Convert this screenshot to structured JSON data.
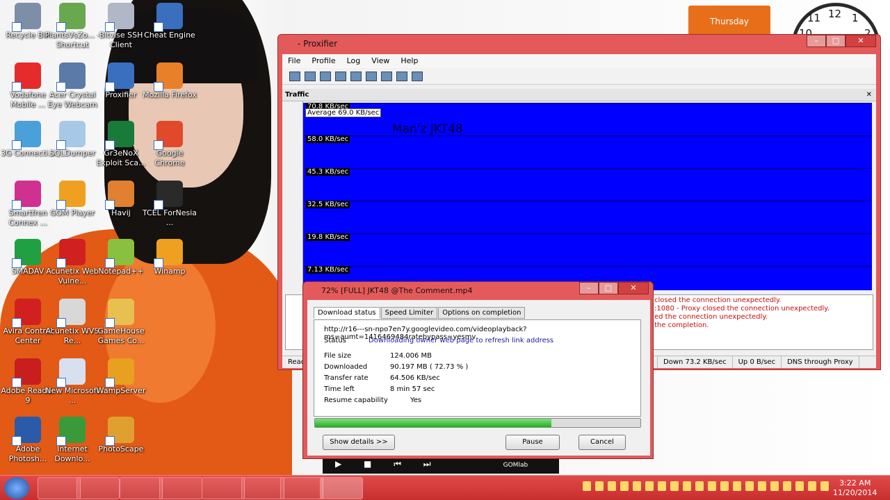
{
  "desktop": {
    "calendar_day": "Thursday",
    "clock_numbers": [
      "10",
      "11",
      "12",
      "1",
      "2"
    ],
    "icons": [
      {
        "label": "Recycle Bin",
        "color": "#7c8ea8"
      },
      {
        "label": "PlantsVsZo... - Shortcut",
        "color": "#6aa84f"
      },
      {
        "label": "Bitvise SSH Client",
        "color": "#b0b8c8"
      },
      {
        "label": "Cheat Engine",
        "color": "#3a6fc0"
      },
      {
        "label": "Vodafone Mobile ...",
        "color": "#e52b2b"
      },
      {
        "label": "Acer Crystal Eye Webcam",
        "color": "#5a7aa8"
      },
      {
        "label": "Proxifier",
        "color": "#3a6fc0"
      },
      {
        "label": "Mozilla Firefox",
        "color": "#e8802a"
      },
      {
        "label": "3G Connecti...",
        "color": "#4aa0d8"
      },
      {
        "label": "SQLDumper",
        "color": "#a8c8e8"
      },
      {
        "label": "Gr3eNoX Exploit Sca...",
        "color": "#1a7a3a"
      },
      {
        "label": "Google Chrome",
        "color": "#e04a2a"
      },
      {
        "label": "Smartfren Connex ...",
        "color": "#d03090"
      },
      {
        "label": "GOM Player",
        "color": "#f0a020"
      },
      {
        "label": "Havij",
        "color": "#e08030"
      },
      {
        "label": "TCEL ForNesia ...",
        "color": "#2a2a2a"
      },
      {
        "label": "SMADAV",
        "color": "#20a040"
      },
      {
        "label": "Acunetix Web Vulne...",
        "color": "#d02020"
      },
      {
        "label": "Notepad++",
        "color": "#8ac040"
      },
      {
        "label": "Winamp",
        "color": "#f0a020"
      },
      {
        "label": "Avira Control Center",
        "color": "#d02020"
      },
      {
        "label": "Acunetix WVS Re...",
        "color": "#d8d8d8"
      },
      {
        "label": "GameHouse Games Co...",
        "color": "#e8c050"
      },
      {
        "label": "Adobe Reader 9",
        "color": "#c81e1e"
      },
      {
        "label": "New Microsoft ...",
        "color": "#d8e0f0"
      },
      {
        "label": "WampServer",
        "color": "#e8a020"
      },
      {
        "label": "Adobe Photosh...",
        "color": "#2a5aa8"
      },
      {
        "label": "Internet Downlo...",
        "color": "#3a9a3a"
      },
      {
        "label": "PhotoScape",
        "color": "#e0a030"
      }
    ]
  },
  "proxifier": {
    "title": "- Proxifier",
    "menu": [
      "File",
      "Profile",
      "Log",
      "View",
      "Help"
    ],
    "traffic_title": "Traffic",
    "close_glyph": "✕",
    "watermark": "Man'z JKT48",
    "average": "Average 69.0 KB/sec",
    "grid_labels": [
      "70.8 KB/sec",
      "58.0 KB/sec",
      "45.3 KB/sec",
      "32.5 KB/sec",
      "19.8 KB/sec",
      "7.13 KB/sec"
    ],
    "log_lines": [
      "closed the connection unexpectedly.",
      ":1080 - Proxy closed the connection unexpectedly.",
      "ed the connection unexpectedly.",
      "the completion."
    ],
    "status": {
      "ready": "Read",
      "down": "Down 73.2 KB/sec",
      "up": "Up 0 B/sec",
      "dns": "DNS through Proxy"
    }
  },
  "download": {
    "title": "72% [FULL] JKT48 @The Comment.mp4",
    "tabs": [
      "Download status",
      "Speed Limiter",
      "Options on completion"
    ],
    "url": "http://r16---sn-npo7en7y.googlevideo.com/videoplayback?ms=aumt=1416469484ratebypass=yesmv",
    "status_label": "Status",
    "status_value": "Downloading owner web page to refresh link address",
    "fields": [
      {
        "k": "File size",
        "v": "124.006  MB"
      },
      {
        "k": "Downloaded",
        "v": "90.197  MB  ( 72.73 % )"
      },
      {
        "k": "Transfer rate",
        "v": "64.506  KB/sec"
      },
      {
        "k": "Time left",
        "v": "8 min 57 sec"
      },
      {
        "k": "Resume capability",
        "v": "Yes"
      }
    ],
    "progress": 0.7273,
    "btn_details": "Show details >>",
    "btn_pause": "Pause",
    "btn_cancel": "Cancel"
  },
  "player": {
    "label": "GOMlab"
  },
  "taskbar": {
    "time": "3:22 AM",
    "date": "11/20/2014"
  }
}
